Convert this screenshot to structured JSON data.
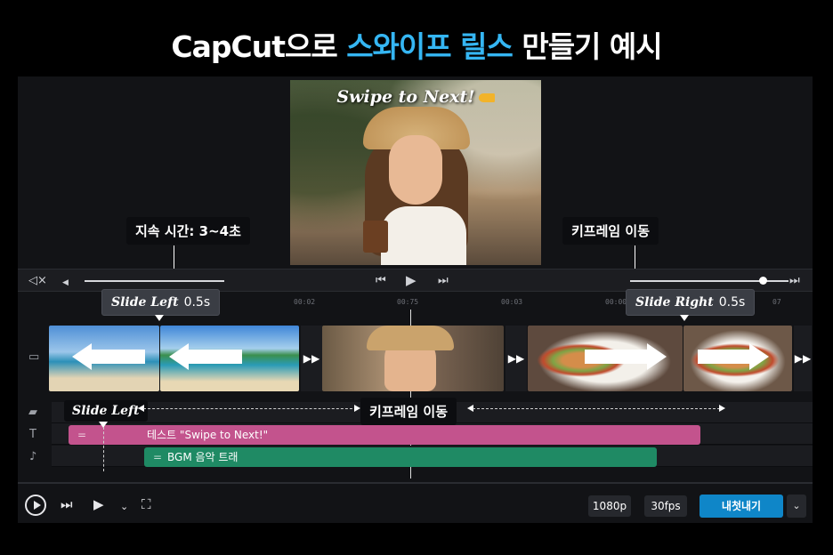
{
  "headline": {
    "prefix": "CapCut으로 ",
    "highlight": "스와이프 릴스",
    "suffix": " 만들기 예시",
    "highlight_color": "#35b6f3"
  },
  "preview": {
    "caption": "Swipe to Next!",
    "caption_icon": "pointing-hand-icon"
  },
  "callouts": {
    "duration": "지속 시간: 3~4초",
    "keyframe_top": "키프레임 이동",
    "slide_left_title": "Slide Left",
    "slide_left_time": "0.5s",
    "slide_right_title": "Slide Right",
    "slide_right_time": "0.5s",
    "track_slide_left": "Slide Left",
    "track_keyframe": "키프레임 이동"
  },
  "transport": {
    "mute_icon": "mute-icon",
    "prev_icon": "skip-back-icon",
    "play_icon": "play-icon",
    "next_icon": "skip-forward-icon",
    "end_icon": "skip-end-icon",
    "volume_level": 0.86
  },
  "ruler": {
    "ticks": [
      "00:02",
      "00:03",
      "00:00",
      "07"
    ],
    "center_tick": "00:75"
  },
  "clips": [
    {
      "kind": "beach",
      "arrow": "left"
    },
    {
      "kind": "beach",
      "arrow": "left"
    },
    {
      "kind": "street-portrait"
    },
    {
      "kind": "food",
      "arrow": "right"
    },
    {
      "kind": "food",
      "arrow": "right"
    }
  ],
  "tracks": {
    "text_clip": "테스트 \"Swipe to Next!\"",
    "audio_clip": "BGM 음악 트래",
    "text_icon": "T",
    "audio_icon": "music-note-icon",
    "clip_icon": "folder-icon",
    "sticker_icon": "sticker-icon"
  },
  "bottom": {
    "resolution": "1080p",
    "fps": "30fps",
    "export": "내첫내기",
    "export_color": "#0f86c8"
  }
}
